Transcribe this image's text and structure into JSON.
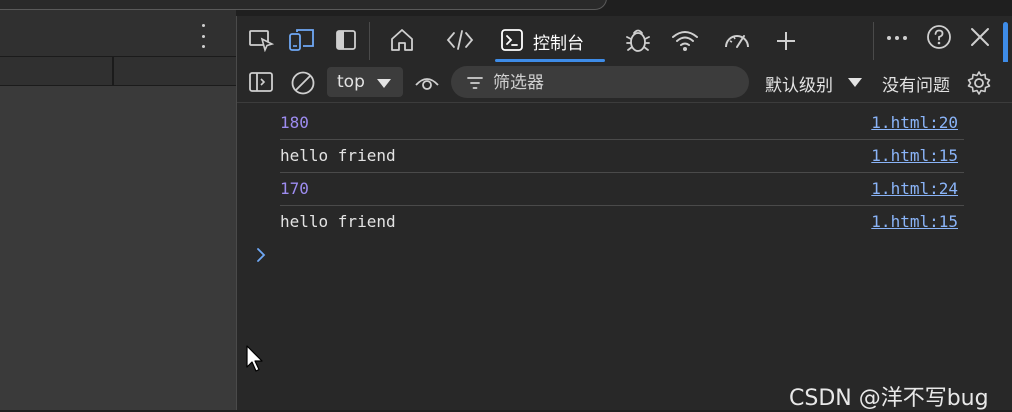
{
  "devtools": {
    "tabs": {
      "console_label": "控制台"
    },
    "toolbar": {
      "context_value": "top",
      "filter_placeholder": "筛选器",
      "levels_label": "默认级别",
      "issues_label": "没有问题"
    },
    "console": {
      "messages": [
        {
          "text": "180",
          "kind": "number",
          "source": "1.html:20"
        },
        {
          "text": "hello friend",
          "kind": "string",
          "source": "1.html:15"
        },
        {
          "text": "170",
          "kind": "number",
          "source": "1.html:24"
        },
        {
          "text": "hello friend",
          "kind": "string",
          "source": "1.html:15"
        }
      ]
    }
  },
  "watermark": "CSDN @洋不写bug",
  "colors": {
    "accent": "#3e8ce8",
    "number_text": "#9d8cf0",
    "link_text": "#8ab4f8",
    "panel_bg": "#282828"
  },
  "icons": [
    "inspect-element-icon",
    "device-toolbar-icon",
    "dock-side-icon",
    "home-icon",
    "elements-code-icon",
    "console-icon",
    "sources-bug-icon",
    "network-wifi-icon",
    "performance-gauge-icon",
    "add-tool-icon",
    "more-options-icon",
    "help-icon",
    "close-icon",
    "sidebar-toggle-icon",
    "clear-console-icon",
    "live-expression-eye-icon",
    "filter-icon",
    "settings-gear-icon",
    "prompt-chevron-icon",
    "mouse-pointer-icon"
  ]
}
